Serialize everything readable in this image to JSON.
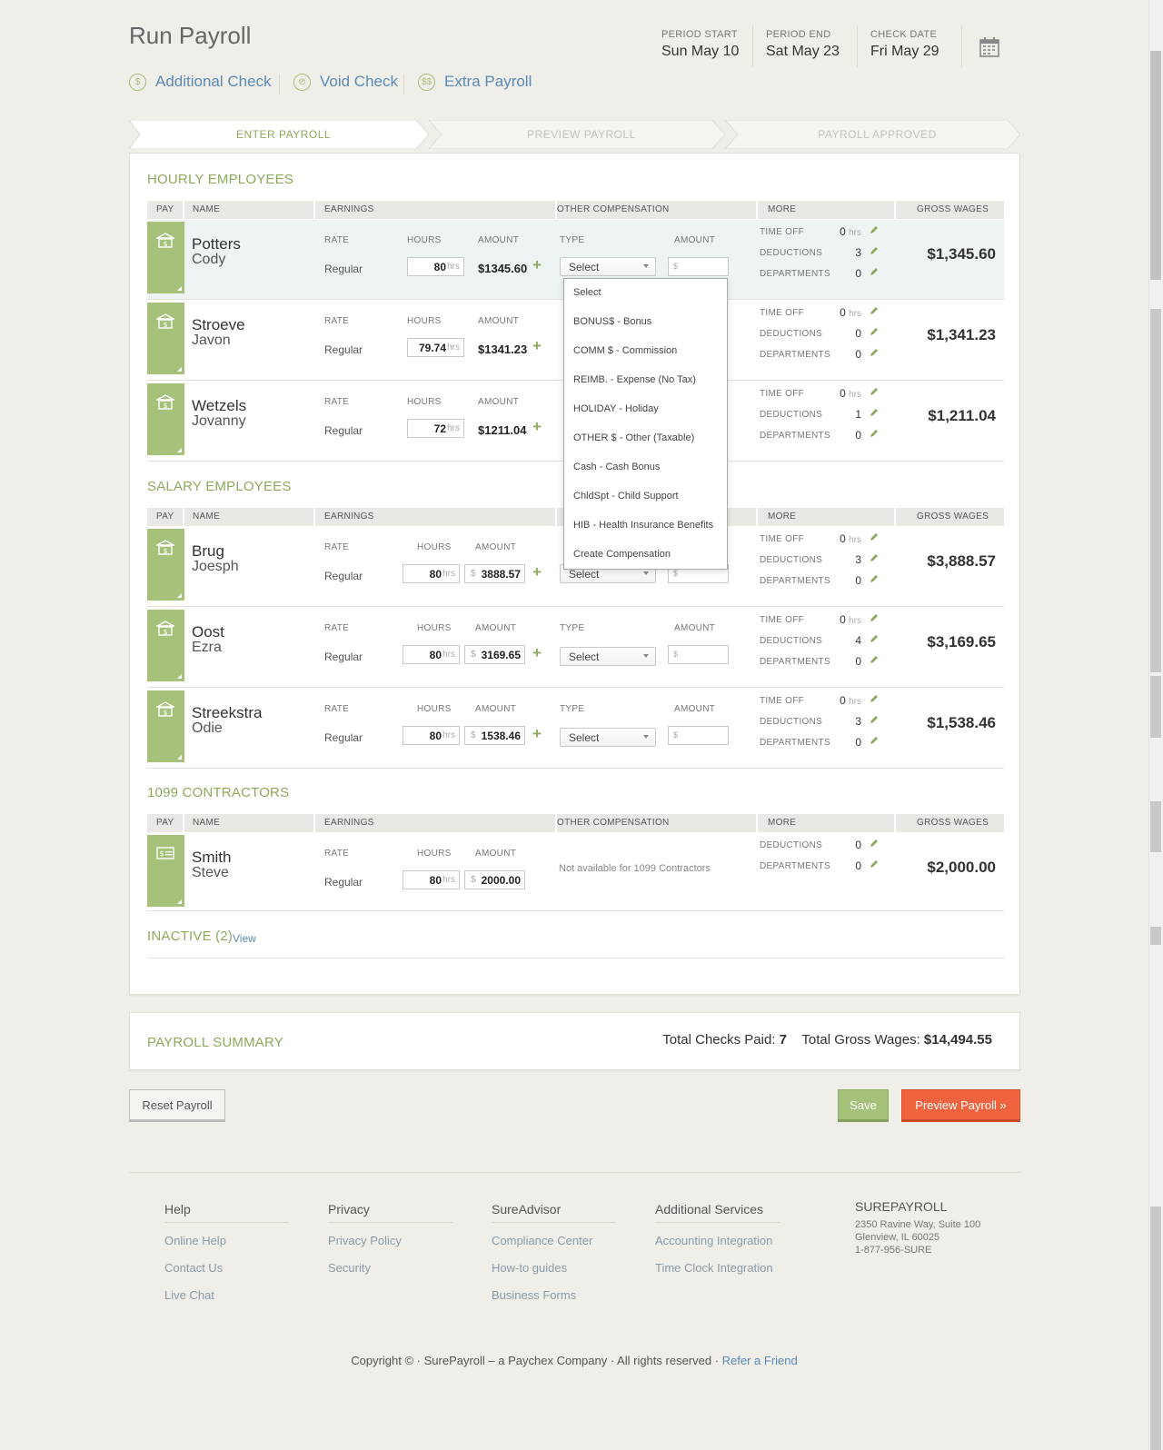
{
  "page": {
    "title": "Run Payroll",
    "period_start_label": "PERIOD START",
    "period_start": "Sun May 10",
    "period_end_label": "PERIOD END",
    "period_end": "Sat May 23",
    "check_date_label": "CHECK DATE",
    "check_date": "Fri May 29"
  },
  "actions": {
    "additional_check": "Additional Check",
    "void_check": "Void Check",
    "extra_payroll": "Extra Payroll"
  },
  "steps": [
    "ENTER PAYROLL",
    "PREVIEW PAYROLL",
    "PAYROLL APPROVED"
  ],
  "columns": {
    "pay": "PAY",
    "name": "NAME",
    "earnings": "EARNINGS",
    "other_comp": "OTHER COMPENSATION",
    "more": "MORE",
    "gross": "GROSS WAGES",
    "rate": "RATE",
    "hours": "HOURS",
    "amount": "AMOUNT",
    "type": "TYPE",
    "amount2": "AMOUNT"
  },
  "labels": {
    "regular": "Regular",
    "hrs": "hrs",
    "dollar": "$",
    "select": "Select",
    "time_off": "TIME OFF",
    "deductions": "DEDUCTIONS",
    "departments": "DEPARTMENTS",
    "not_available": "Not available for 1099 Contractors"
  },
  "sections": {
    "hourly": "HOURLY EMPLOYEES",
    "salary": "SALARY EMPLOYEES",
    "contractors": "1099 CONTRACTORS",
    "inactive": "INACTIVE (2)",
    "inactive_view": "View"
  },
  "hourly": [
    {
      "last": "Potters",
      "first": "Cody",
      "hours": "80",
      "amount": "$1345.60",
      "time_off": "0",
      "deductions": "3",
      "departments": "0",
      "gross": "$1,345.60"
    },
    {
      "last": "Stroeve",
      "first": "Javon",
      "hours": "79.74",
      "amount": "$1341.23",
      "time_off": "0",
      "deductions": "0",
      "departments": "0",
      "gross": "$1,341.23"
    },
    {
      "last": "Wetzels",
      "first": "Jovanny",
      "hours": "72",
      "amount": "$1211.04",
      "time_off": "0",
      "deductions": "1",
      "departments": "0",
      "gross": "$1,211.04"
    }
  ],
  "salary": [
    {
      "last": "Brug",
      "first": "Joesph",
      "hours": "80",
      "amount": "3888.57",
      "time_off": "0",
      "deductions": "3",
      "departments": "0",
      "gross": "$3,888.57"
    },
    {
      "last": "Oost",
      "first": "Ezra",
      "hours": "80",
      "amount": "3169.65",
      "time_off": "0",
      "deductions": "4",
      "departments": "0",
      "gross": "$3,169.65"
    },
    {
      "last": "Streekstra",
      "first": "Odie",
      "hours": "80",
      "amount": "1538.46",
      "time_off": "0",
      "deductions": "3",
      "departments": "0",
      "gross": "$1,538.46"
    }
  ],
  "contractors": [
    {
      "last": "Smith",
      "first": "Steve",
      "hours": "80",
      "amount": "2000.00",
      "deductions": "0",
      "departments": "0",
      "gross": "$2,000.00"
    }
  ],
  "dropdown": [
    "Select",
    "BONUS$ - Bonus",
    "COMM $ - Commission",
    "REIMB. - Expense (No Tax)",
    "HOLIDAY - Holiday",
    "OTHER $ - Other (Taxable)",
    "Cash - Cash Bonus",
    "ChldSpt - Child Support",
    "HIB - Health Insurance Benefits",
    "Create Compensation"
  ],
  "summary": {
    "title": "PAYROLL SUMMARY",
    "checks_label": "Total Checks Paid:",
    "checks_value": "7",
    "gross_label": "Total Gross Wages:",
    "gross_value": "$14,494.55"
  },
  "buttons": {
    "reset": "Reset Payroll",
    "save": "Save",
    "preview": "Preview Payroll »"
  },
  "footer": {
    "columns": [
      {
        "head": "Help",
        "links": [
          "Online Help",
          "Contact Us",
          "Live Chat"
        ]
      },
      {
        "head": "Privacy",
        "links": [
          "Privacy Policy",
          "Security"
        ]
      },
      {
        "head": "SureAdvisor",
        "links": [
          "Compliance Center",
          "How-to guides",
          "Business Forms"
        ]
      },
      {
        "head": "Additional Services",
        "links": [
          "Accounting Integration",
          "Time Clock Integration"
        ]
      }
    ],
    "company": "SUREPAYROLL",
    "address1": "2350 Ravine Way, Suite 100",
    "address2": "Glenview, IL 60025",
    "phone": "1-877-956-SURE",
    "copyright": "Copyright © · SurePayroll – a Paychex Company · All rights reserved ·",
    "refer": "Refer a Friend"
  },
  "colors": {
    "green": "#a5c17a",
    "accent_green": "#8daa5c",
    "link_blue": "#5a8ab5",
    "orange": "#f0633f"
  }
}
